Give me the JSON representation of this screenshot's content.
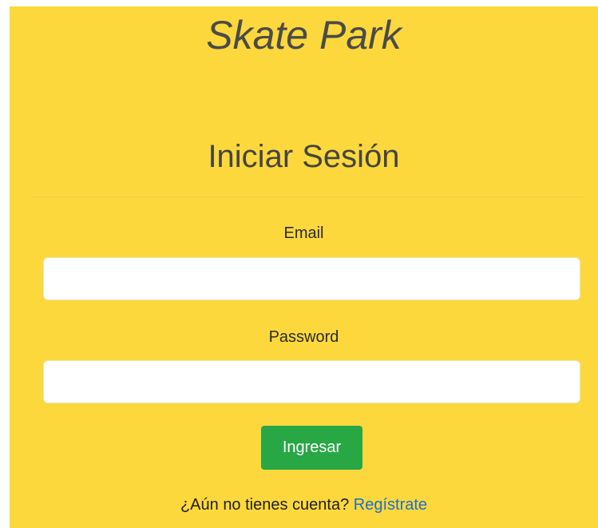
{
  "brand": {
    "title": "Skate Park"
  },
  "login": {
    "heading": "Iniciar Sesión",
    "email_label": "Email",
    "email_value": "",
    "password_label": "Password",
    "password_value": "",
    "submit_label": "Ingresar",
    "register_prompt": "¿Aún no tienes cuenta?",
    "register_link": "Regístrate"
  },
  "colors": {
    "background": "#fcd83d",
    "button": "#28a745",
    "link": "#1e6fc6",
    "text": "#454540"
  }
}
